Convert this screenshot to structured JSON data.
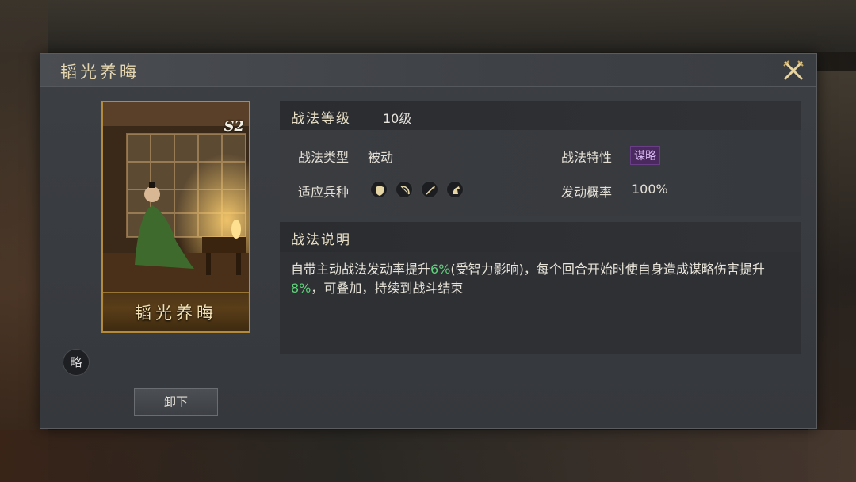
{
  "dialog": {
    "title": "韬光养晦",
    "close_icon": "crossed-swords-close-icon"
  },
  "card": {
    "name": "韬光养晦",
    "season": "S2",
    "type_short": "略"
  },
  "level": {
    "label": "战法等级",
    "value": "10级"
  },
  "info": {
    "type_label": "战法类型",
    "type_value": "被动",
    "trait_label": "战法特性",
    "trait_value": "谋略",
    "troops_label": "适应兵种",
    "troop_icons": [
      "shield-icon",
      "bow-icon",
      "spear-icon",
      "horse-icon"
    ],
    "rate_label": "发动概率",
    "rate_value": "100%"
  },
  "description": {
    "label": "战法说明",
    "part1": "自带主动战法发动率提升",
    "hl1": "6%",
    "part2": "(受智力影响)，每个回合开始时使自身造成谋略伤害提升",
    "hl2": "8%",
    "part3": "，可叠加，持续到战斗结束"
  },
  "buttons": {
    "unequip": "卸下"
  },
  "colors": {
    "highlight": "#5fd07a",
    "gold": "#b48a3c",
    "trait_bg": "#4a2a5e"
  }
}
